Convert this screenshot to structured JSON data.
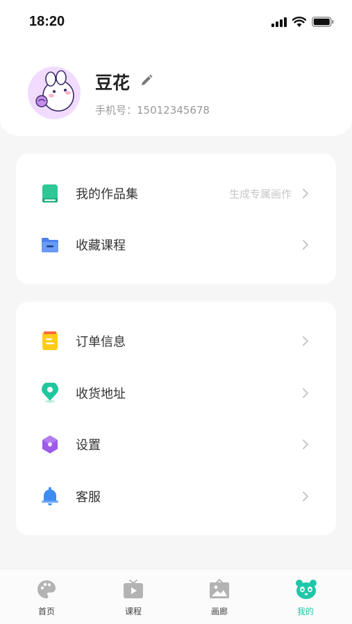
{
  "status_bar": {
    "time": "18:20"
  },
  "profile": {
    "name": "豆花",
    "phone_label": "手机号：15012345678"
  },
  "menu_group_1": [
    {
      "label": "我的作品集",
      "hint": "生成专属画作",
      "icon": "book-icon",
      "color": "#2ec795"
    },
    {
      "label": "收藏课程",
      "hint": "",
      "icon": "folder-icon",
      "color": "#4d82ee"
    }
  ],
  "menu_group_2": [
    {
      "label": "订单信息",
      "icon": "order-icon",
      "color": "#ffcc1a"
    },
    {
      "label": "收货地址",
      "icon": "location-pin-icon",
      "color": "#20c69d"
    },
    {
      "label": "设置",
      "icon": "settings-hexagon-icon",
      "color": "#9d5be8"
    },
    {
      "label": "客服",
      "icon": "bell-icon",
      "color": "#3e8bf2"
    }
  ],
  "tabbar": {
    "items": [
      {
        "label": "首页",
        "icon": "palette-icon"
      },
      {
        "label": "课程",
        "icon": "tv-play-icon"
      },
      {
        "label": "画廊",
        "icon": "picture-frame-icon"
      },
      {
        "label": "我的",
        "icon": "panda-icon"
      }
    ],
    "active_index": 3,
    "active_color": "#1fc7a7",
    "inactive_color": "#b3b3b3"
  }
}
